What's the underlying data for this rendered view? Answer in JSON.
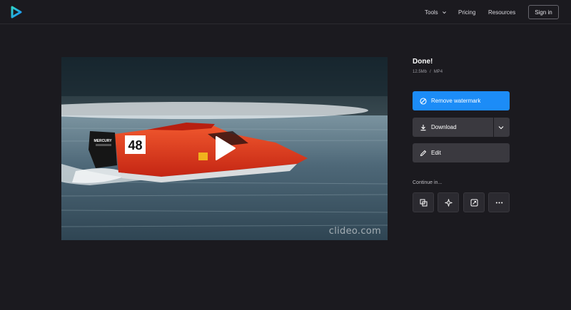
{
  "header": {
    "logo_icon": "clideo-play-logo-icon",
    "nav": {
      "tools_label": "Tools",
      "pricing_label": "Pricing",
      "resources_label": "Resources"
    },
    "signin_label": "Sign in"
  },
  "video": {
    "thumbnail": "red racing powerboat number 48 speeding across blue water",
    "boat_number": "48",
    "engine_brand": "MERCURY",
    "watermark": "clideo.com",
    "play_icon": "play-icon"
  },
  "result": {
    "title": "Done!",
    "file_size": "12.5Mb",
    "separator": "/",
    "file_format": "MP4"
  },
  "actions": {
    "remove_watermark_label": "Remove watermark",
    "download_label": "Download",
    "edit_label": "Edit"
  },
  "continue": {
    "label": "Continue in...",
    "tools": [
      {
        "icon": "merge-icon"
      },
      {
        "icon": "sparkle-icon"
      },
      {
        "icon": "crop-icon"
      },
      {
        "icon": "more-icon"
      }
    ]
  },
  "colors": {
    "background": "#1b1a1f",
    "accent": "#1c8cf7",
    "button_dark": "#3a393f",
    "boat_red": "#e03a22"
  }
}
